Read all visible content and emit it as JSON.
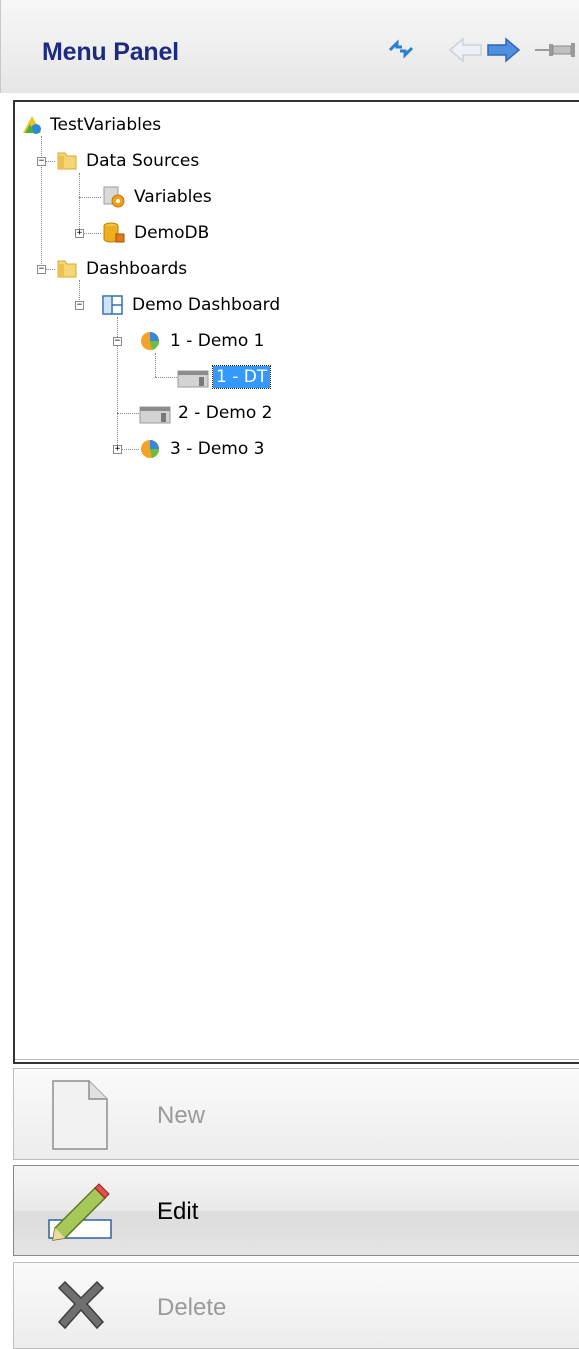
{
  "header": {
    "title": "Menu Panel"
  },
  "tree": {
    "root": "TestVariables",
    "data_sources": "Data Sources",
    "variables": "Variables",
    "demodb": "DemoDB",
    "dashboards": "Dashboards",
    "demo_dashboard": "Demo Dashboard",
    "demo1": "1 - Demo 1",
    "dt": "1 - DT",
    "demo2": "2 - Demo 2",
    "demo3": "3 - Demo 3"
  },
  "actions": {
    "new": "New",
    "edit": "Edit",
    "delete": "Delete"
  },
  "colors": {
    "title": "#1c2a80",
    "selection": "#3399ff"
  }
}
